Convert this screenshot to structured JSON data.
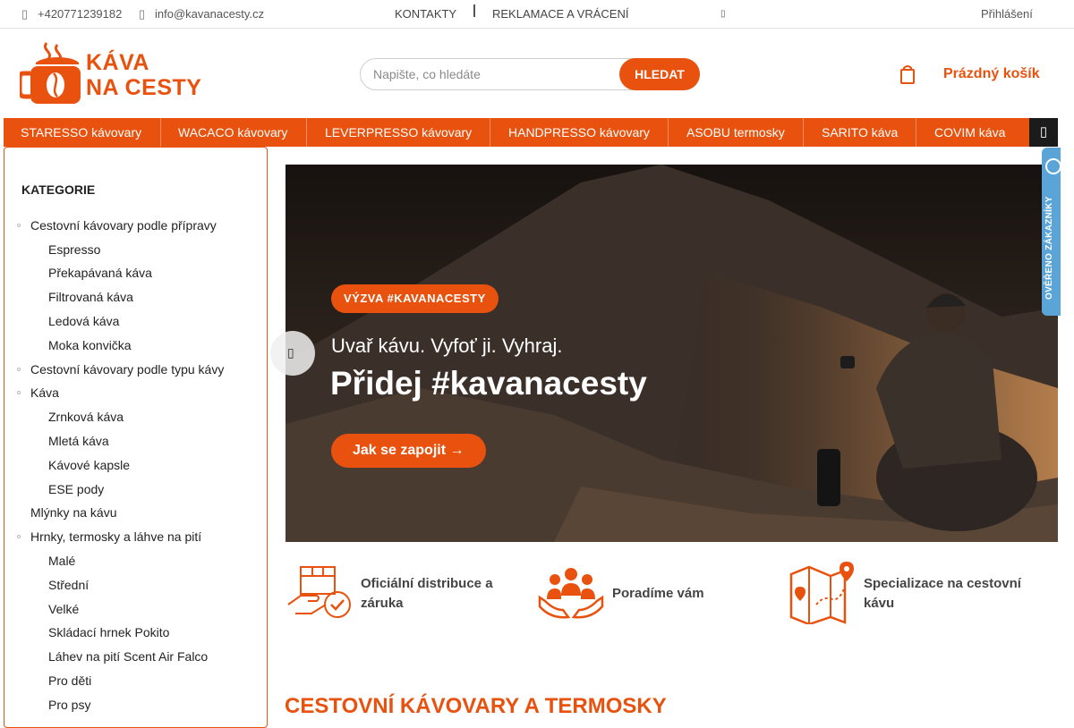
{
  "topbar": {
    "phone": "+420771239182",
    "email": "info@kavanacesty.cz",
    "links": [
      "KONTAKTY",
      "REKLAMACE A VRÁCENÍ"
    ],
    "login": "Přihlášení"
  },
  "logo": {
    "line1": "KÁVA",
    "line2": "NA CESTY"
  },
  "search": {
    "placeholder": "Napište, co hledáte",
    "button": "HLEDAT"
  },
  "cart": {
    "label": "Prázdný košík"
  },
  "nav": {
    "items": [
      "STARESSO kávovary",
      "WACACO kávovary",
      "LEVERPRESSO kávovary",
      "HANDPRESSO kávovary",
      "ASOBU termosky",
      "SARITO káva",
      "COVIM káva"
    ]
  },
  "sidebar": {
    "heading": "KATEGORIE",
    "categories": [
      "Cestovní kávovary podle přípravy",
      "Espresso",
      "Překapávaná káva",
      "Filtrovaná káva",
      "Ledová káva",
      "Moka konvička",
      "Cestovní kávovary podle typu kávy",
      "Káva",
      "Zrnková káva",
      "Mletá káva",
      "Kávové kapsle",
      "ESE pody",
      "Mlýnky na kávu",
      "Hrnky, termosky a láhve na pití",
      "Malé",
      "Střední",
      "Velké",
      "Skládací hrnek Pokito",
      "Láhev na pití Scent Air Falco",
      "Pro děti",
      "Pro psy"
    ]
  },
  "banner": {
    "badge": "VÝZVA #KAVANACESTY",
    "line1": "Uvař kávu.  Vyfoť ji.  Vyhraj.",
    "line2": "Přidej #kavanacesty",
    "cta": "Jak se zapojit →"
  },
  "reviews": {
    "label": "OVĚŘENO ZÁKAZNÍKY"
  },
  "features": [
    {
      "icon": "box-check-icon",
      "text_a": "Oficiální distribuce a",
      "text_b": "záruka"
    },
    {
      "icon": "people-hands-icon",
      "text_a": "Poradíme vám",
      "text_b": ""
    },
    {
      "icon": "map-pin-icon",
      "text_a": "Specializace na cestovní",
      "text_b": "kávu"
    }
  ],
  "section_title": "CESTOVNÍ KÁVOVARY A TERMOSKY",
  "colors": {
    "accent": "#e8520e",
    "nav_more": "#1b1b1b",
    "reviews": "#5aa4d8"
  }
}
